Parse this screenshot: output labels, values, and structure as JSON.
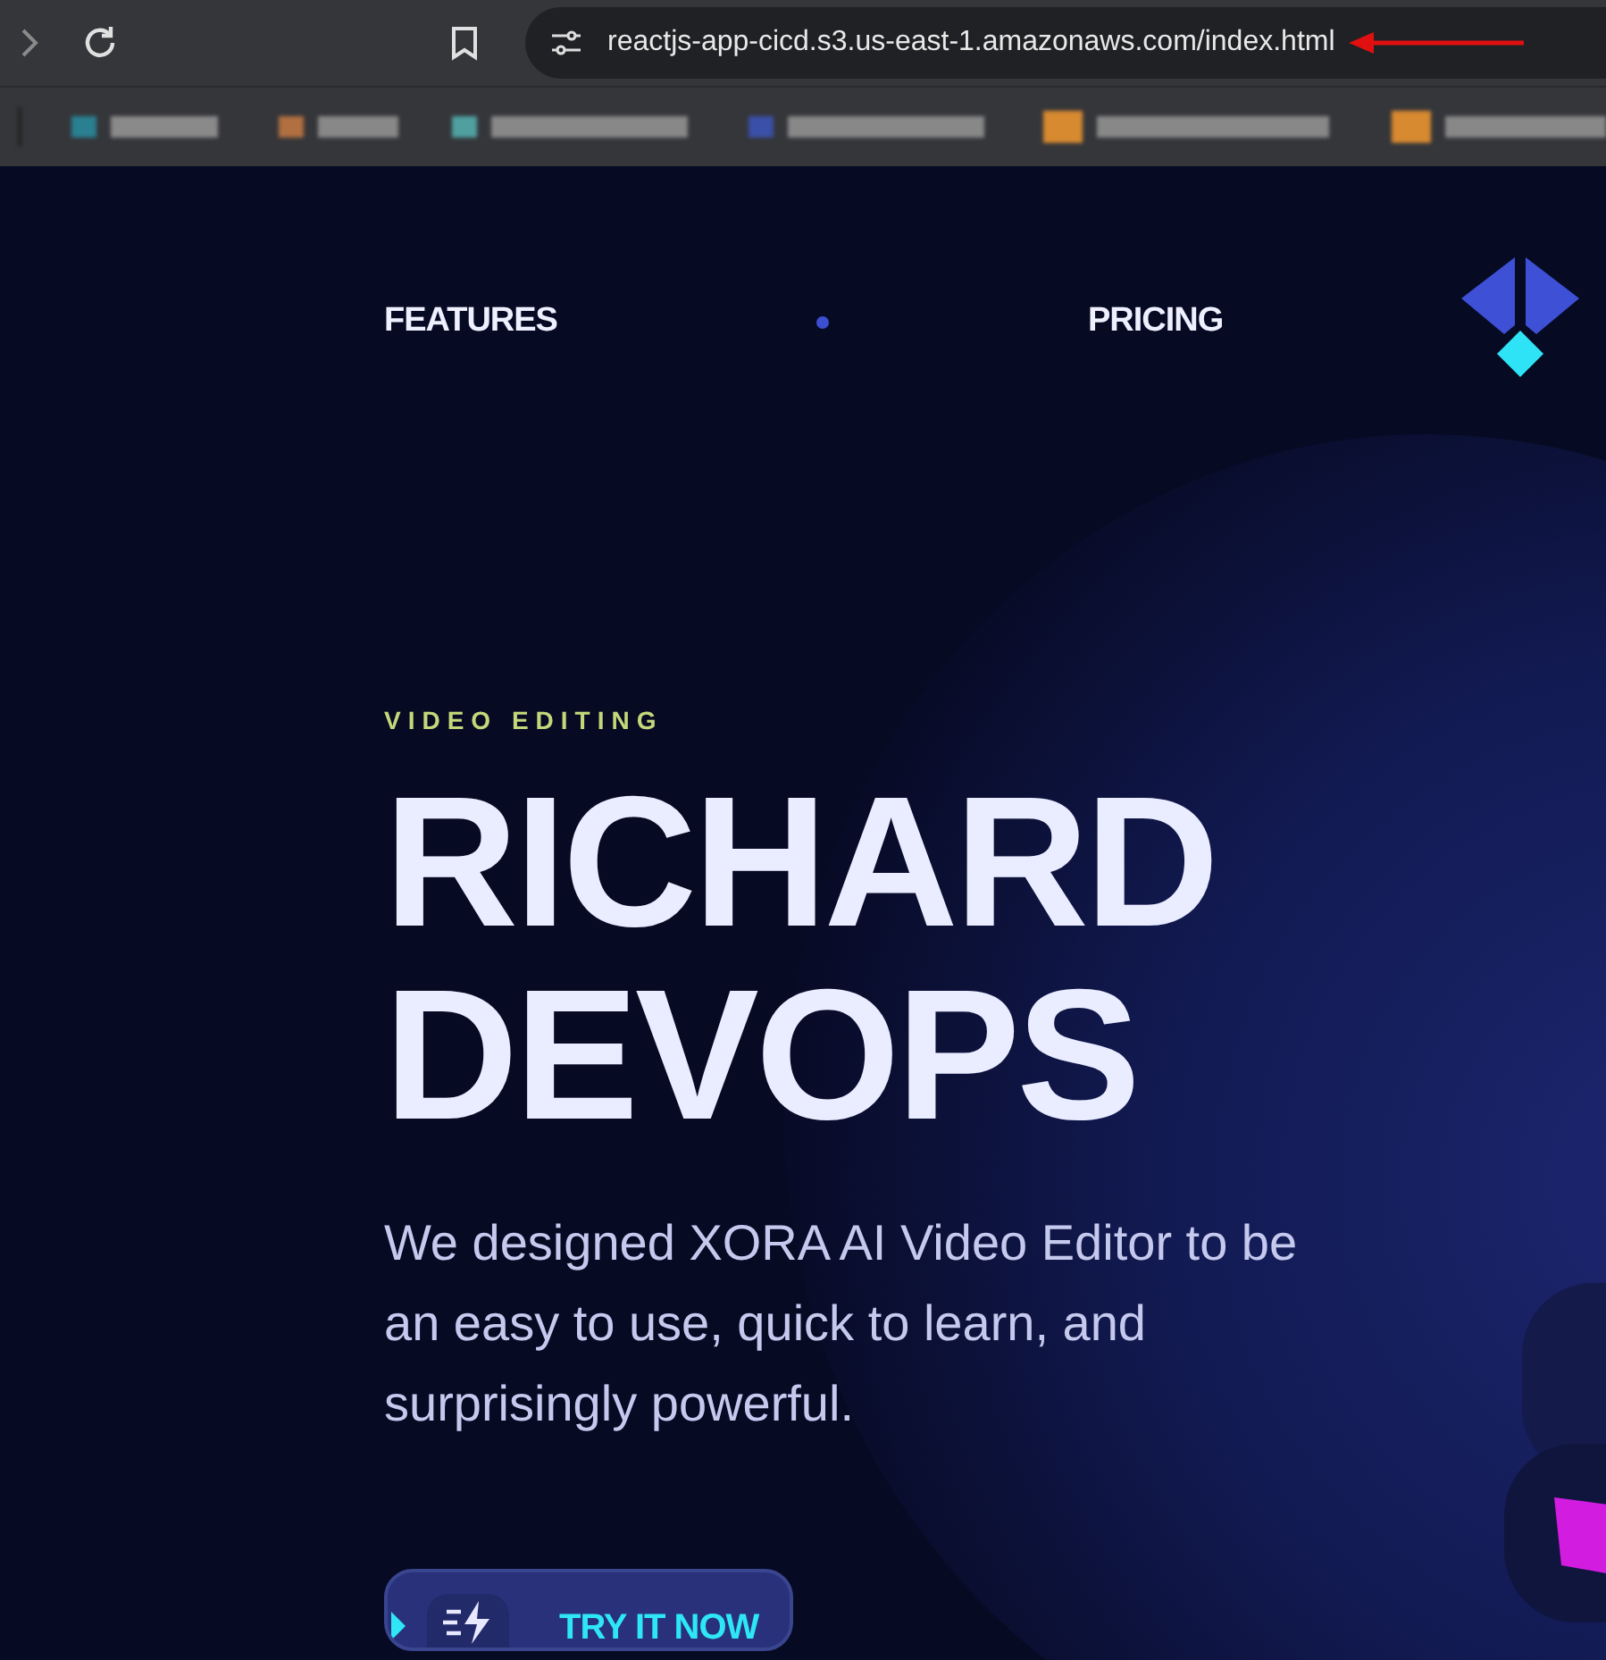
{
  "browser": {
    "url": "reactjs-app-cicd.s3.us-east-1.amazonaws.com/index.html"
  },
  "nav": {
    "items": [
      {
        "label": "FEATURES"
      },
      {
        "label": "PRICING"
      }
    ]
  },
  "hero": {
    "eyebrow": "VIDEO EDITING",
    "title_lines": [
      "RICHARD",
      "DEVOPS"
    ],
    "description": "We designed XORA AI Video Editor to be an easy to use, quick to learn, and surprisingly powerful.",
    "button": {
      "label": "TRY IT NOW"
    }
  }
}
